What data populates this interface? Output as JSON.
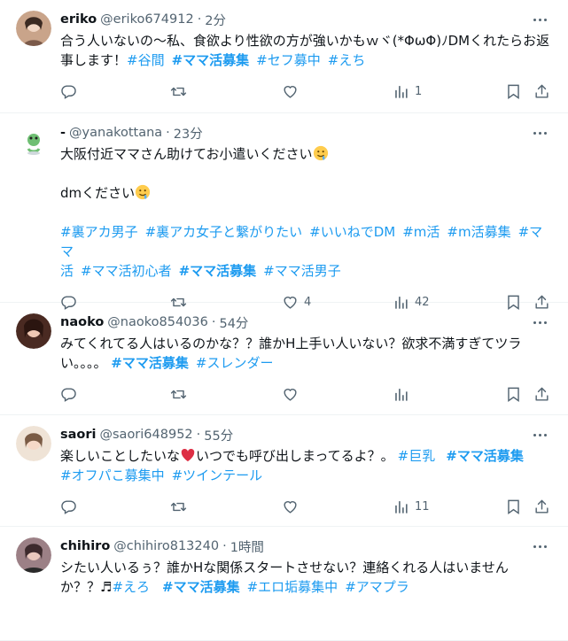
{
  "tweets": [
    {
      "name": "eriko",
      "handle": "@eriko674912",
      "time": "2分",
      "text": "合う人いないの〜私、食欲より性欲の方が強いかもｗヾ(*ΦωΦ)ﾉDMくれたらお返事します！",
      "tags": [
        "#谷間",
        "#ママ活募集",
        "#セフ募中",
        "#えち"
      ],
      "views": "1",
      "avatar_color": "#c9a48a"
    },
    {
      "name": "-",
      "handle": "@yanakottana",
      "time": "23分",
      "line1": "大阪付近ママさん助けてお小遣いください",
      "line2": "dmください",
      "tags_line1": [
        "#裏アカ男子",
        "#裏アカ女子と繋がりたい",
        "#いいねでDM",
        "#m活",
        "#m活募集",
        "#ママ"
      ],
      "tags_line2": [
        "活",
        "#ママ活初心者",
        "#ママ活募集",
        "#ママ活男子"
      ],
      "likes": "4",
      "views": "42",
      "avatar_color": "#dfe9e0"
    },
    {
      "name": "naoko",
      "handle": "@naoko854036",
      "time": "54分",
      "text": "みてくれてる人はいるのかな？？誰かH上手い人いない？欲求不満すぎてツラい。。。。",
      "tags": [
        "#ママ活募集",
        "#スレンダー"
      ],
      "avatar_color": "#6b3a2f"
    },
    {
      "name": "saori",
      "handle": "@saori648952",
      "time": "55分",
      "text_a": "楽しいことしたいな",
      "text_b": "いつでも呼び出しまってるよ？。",
      "tags_line1": [
        "#巨乳",
        "#ママ活募集"
      ],
      "tags_line2": [
        "#オフパこ募集中",
        "#ツインテール"
      ],
      "views": "11",
      "heart_color": "#e0245e",
      "avatar_color": "#e7d7c8"
    },
    {
      "name": "chihiro",
      "handle": "@chihiro813240",
      "time": "1時間",
      "text_line1": "シたい人いるぅ？誰かHな関係スタートさせない？連絡くれる人はいません",
      "text_line2": "か？？♬",
      "tags": [
        "#えろ",
        "#ママ活募集",
        "#エロ垢募集中",
        "#アマプラ"
      ],
      "avatar_color": "#8a6d74"
    }
  ],
  "icons": {
    "reply": "reply-icon",
    "retweet": "retweet-icon",
    "like": "heart-icon",
    "views": "views-icon",
    "bookmark": "bookmark-icon",
    "share": "share-icon",
    "more": "more-icon"
  },
  "colors": {
    "link": "#1d9bf0",
    "secondary": "#536471",
    "border": "#eff3f4"
  }
}
